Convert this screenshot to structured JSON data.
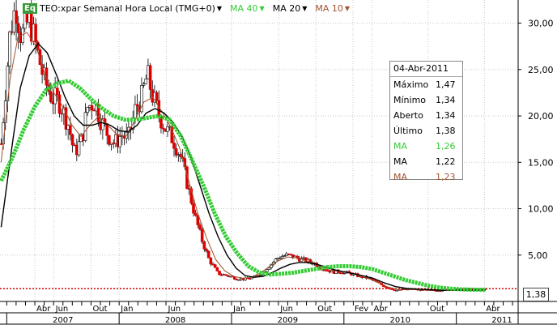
{
  "header": {
    "symbol_badge": "Eq",
    "title": "TEO:xpar Semanal Hora Local (TMG+0)",
    "indicators": [
      {
        "label": "MA 40",
        "color": "#33cc33"
      },
      {
        "label": "MA 20",
        "color": "#000000"
      },
      {
        "label": "MA 10",
        "color": "#a0522d"
      }
    ]
  },
  "info_panel": {
    "date": "04-Abr-2011",
    "rows": [
      {
        "label": "Máximo",
        "value": "1,47",
        "color": "#000000"
      },
      {
        "label": "Mínimo",
        "value": "1,34",
        "color": "#000000"
      },
      {
        "label": "Aberto",
        "value": "1,34",
        "color": "#000000"
      },
      {
        "label": "Último",
        "value": "1,38",
        "color": "#000000"
      },
      {
        "label": "MA",
        "value": "1,26",
        "color": "#33cc33"
      },
      {
        "label": "MA",
        "value": "1,22",
        "color": "#000000"
      },
      {
        "label": "MA",
        "value": "1,23",
        "color": "#a0522d"
      }
    ]
  },
  "last_price_label": "1,38",
  "chart_data": {
    "type": "candlestick",
    "y_ticks": [
      "5,00",
      "10,00",
      "15,00",
      "20,00",
      "25,00",
      "30,00"
    ],
    "y_tick_values": [
      5,
      10,
      15,
      20,
      25,
      30
    ],
    "ylim": [
      0,
      32.5
    ],
    "month_labels": [
      {
        "t": 2007.25,
        "label": "Abr"
      },
      {
        "t": 2007.42,
        "label": "Jun"
      },
      {
        "t": 2007.75,
        "label": "Out"
      },
      {
        "t": 2008.0,
        "label": "Jan"
      },
      {
        "t": 2008.42,
        "label": "Jun"
      },
      {
        "t": 2009.0,
        "label": "Jan"
      },
      {
        "t": 2009.42,
        "label": "Jun"
      },
      {
        "t": 2009.75,
        "label": "Out"
      },
      {
        "t": 2010.08,
        "label": "Fev"
      },
      {
        "t": 2010.25,
        "label": "Abr"
      },
      {
        "t": 2010.75,
        "label": "Out"
      },
      {
        "t": 2011.25,
        "label": "Abr"
      }
    ],
    "year_labels": [
      {
        "t": 2007.5,
        "label": "2007"
      },
      {
        "t": 2008.5,
        "label": "2008"
      },
      {
        "t": 2009.5,
        "label": "2009"
      },
      {
        "t": 2010.5,
        "label": "2010"
      },
      {
        "t": 2011.5,
        "label": "2011"
      }
    ],
    "x_range": [
      2006.94,
      2011.55
    ],
    "price_path": [
      [
        2006.95,
        17.0
      ],
      [
        2007.03,
        29.0
      ],
      [
        2007.08,
        32.0
      ],
      [
        2007.13,
        28.5
      ],
      [
        2007.2,
        30.5
      ],
      [
        2007.27,
        27.0
      ],
      [
        2007.33,
        24.0
      ],
      [
        2007.4,
        22.0
      ],
      [
        2007.47,
        21.5
      ],
      [
        2007.55,
        19.0
      ],
      [
        2007.6,
        16.0
      ],
      [
        2007.67,
        17.5
      ],
      [
        2007.72,
        21.0
      ],
      [
        2007.78,
        21.5
      ],
      [
        2007.84,
        19.5
      ],
      [
        2007.9,
        18.0
      ],
      [
        2007.96,
        17.0
      ],
      [
        2008.02,
        18.0
      ],
      [
        2008.08,
        17.5
      ],
      [
        2008.15,
        21.0
      ],
      [
        2008.2,
        22.0
      ],
      [
        2008.25,
        24.5
      ],
      [
        2008.3,
        22.0
      ],
      [
        2008.36,
        20.0
      ],
      [
        2008.42,
        18.5
      ],
      [
        2008.48,
        17.5
      ],
      [
        2008.55,
        15.5
      ],
      [
        2008.62,
        12.0
      ],
      [
        2008.68,
        9.0
      ],
      [
        2008.74,
        6.5
      ],
      [
        2008.8,
        4.5
      ],
      [
        2008.88,
        3.0
      ],
      [
        2008.96,
        2.8
      ],
      [
        2009.04,
        2.5
      ],
      [
        2009.12,
        2.4
      ],
      [
        2009.2,
        2.6
      ],
      [
        2009.28,
        3.2
      ],
      [
        2009.35,
        4.0
      ],
      [
        2009.42,
        4.8
      ],
      [
        2009.5,
        5.0
      ],
      [
        2009.58,
        4.7
      ],
      [
        2009.66,
        4.4
      ],
      [
        2009.74,
        4.1
      ],
      [
        2009.82,
        3.5
      ],
      [
        2009.9,
        3.2
      ],
      [
        2009.98,
        3.2
      ],
      [
        2010.06,
        3.0
      ],
      [
        2010.14,
        2.7
      ],
      [
        2010.22,
        2.5
      ],
      [
        2010.3,
        2.0
      ],
      [
        2010.38,
        1.5
      ],
      [
        2010.46,
        1.2
      ],
      [
        2010.55,
        1.3
      ],
      [
        2010.63,
        1.3
      ],
      [
        2010.72,
        1.2
      ],
      [
        2010.8,
        1.2
      ],
      [
        2010.9,
        1.25
      ],
      [
        2011.0,
        1.3
      ],
      [
        2011.1,
        1.35
      ],
      [
        2011.18,
        1.3
      ],
      [
        2011.26,
        1.38
      ]
    ],
    "ma40_path": [
      [
        2006.95,
        13.0
      ],
      [
        2007.05,
        15.5
      ],
      [
        2007.15,
        18.5
      ],
      [
        2007.25,
        21.0
      ],
      [
        2007.35,
        22.8
      ],
      [
        2007.45,
        23.5
      ],
      [
        2007.55,
        23.8
      ],
      [
        2007.65,
        23.0
      ],
      [
        2007.75,
        21.8
      ],
      [
        2007.85,
        20.8
      ],
      [
        2007.95,
        20.0
      ],
      [
        2008.05,
        19.6
      ],
      [
        2008.15,
        19.6
      ],
      [
        2008.25,
        19.8
      ],
      [
        2008.35,
        20.0
      ],
      [
        2008.45,
        19.6
      ],
      [
        2008.55,
        17.8
      ],
      [
        2008.65,
        15.2
      ],
      [
        2008.75,
        12.5
      ],
      [
        2008.85,
        9.5
      ],
      [
        2008.95,
        7.0
      ],
      [
        2009.05,
        5.2
      ],
      [
        2009.15,
        3.8
      ],
      [
        2009.25,
        3.1
      ],
      [
        2009.35,
        2.9
      ],
      [
        2009.45,
        3.0
      ],
      [
        2009.55,
        3.1
      ],
      [
        2009.65,
        3.3
      ],
      [
        2009.75,
        3.5
      ],
      [
        2009.85,
        3.7
      ],
      [
        2009.95,
        3.8
      ],
      [
        2010.05,
        3.8
      ],
      [
        2010.15,
        3.7
      ],
      [
        2010.25,
        3.5
      ],
      [
        2010.35,
        3.1
      ],
      [
        2010.45,
        2.7
      ],
      [
        2010.55,
        2.3
      ],
      [
        2010.65,
        2.0
      ],
      [
        2010.75,
        1.7
      ],
      [
        2010.85,
        1.5
      ],
      [
        2010.95,
        1.38
      ],
      [
        2011.05,
        1.3
      ],
      [
        2011.15,
        1.27
      ],
      [
        2011.26,
        1.26
      ]
    ],
    "ma20_path": [
      [
        2006.95,
        8.0
      ],
      [
        2007.05,
        17.0
      ],
      [
        2007.12,
        23.0
      ],
      [
        2007.2,
        26.5
      ],
      [
        2007.28,
        27.8
      ],
      [
        2007.36,
        26.8
      ],
      [
        2007.44,
        24.5
      ],
      [
        2007.52,
        22.0
      ],
      [
        2007.6,
        20.0
      ],
      [
        2007.68,
        19.0
      ],
      [
        2007.76,
        19.0
      ],
      [
        2007.84,
        19.3
      ],
      [
        2007.92,
        19.0
      ],
      [
        2008.0,
        18.4
      ],
      [
        2008.08,
        18.3
      ],
      [
        2008.16,
        19.0
      ],
      [
        2008.24,
        20.3
      ],
      [
        2008.32,
        20.8
      ],
      [
        2008.4,
        20.3
      ],
      [
        2008.48,
        19.3
      ],
      [
        2008.56,
        17.8
      ],
      [
        2008.64,
        15.5
      ],
      [
        2008.72,
        12.5
      ],
      [
        2008.8,
        9.5
      ],
      [
        2008.88,
        7.0
      ],
      [
        2008.96,
        5.0
      ],
      [
        2009.04,
        3.6
      ],
      [
        2009.12,
        2.8
      ],
      [
        2009.2,
        2.6
      ],
      [
        2009.28,
        2.7
      ],
      [
        2009.36,
        3.1
      ],
      [
        2009.44,
        3.6
      ],
      [
        2009.52,
        4.0
      ],
      [
        2009.6,
        4.2
      ],
      [
        2009.68,
        4.2
      ],
      [
        2009.76,
        4.0
      ],
      [
        2009.84,
        3.7
      ],
      [
        2009.92,
        3.4
      ],
      [
        2010.0,
        3.2
      ],
      [
        2010.08,
        3.0
      ],
      [
        2010.16,
        2.8
      ],
      [
        2010.26,
        2.5
      ],
      [
        2010.36,
        2.0
      ],
      [
        2010.46,
        1.6
      ],
      [
        2010.56,
        1.4
      ],
      [
        2010.7,
        1.3
      ],
      [
        2010.85,
        1.22
      ],
      [
        2011.0,
        1.2
      ],
      [
        2011.15,
        1.21
      ],
      [
        2011.26,
        1.22
      ]
    ],
    "ma10_path": [
      [
        2006.95,
        15.0
      ],
      [
        2007.03,
        24.0
      ],
      [
        2007.1,
        28.5
      ],
      [
        2007.18,
        29.0
      ],
      [
        2007.26,
        27.5
      ],
      [
        2007.34,
        24.5
      ],
      [
        2007.42,
        22.5
      ],
      [
        2007.5,
        21.0
      ],
      [
        2007.58,
        19.0
      ],
      [
        2007.66,
        17.8
      ],
      [
        2007.74,
        19.0
      ],
      [
        2007.82,
        20.0
      ],
      [
        2007.9,
        19.0
      ],
      [
        2007.98,
        18.0
      ],
      [
        2008.06,
        17.8
      ],
      [
        2008.14,
        19.5
      ],
      [
        2008.22,
        21.5
      ],
      [
        2008.3,
        22.0
      ],
      [
        2008.38,
        20.5
      ],
      [
        2008.46,
        18.8
      ],
      [
        2008.54,
        16.5
      ],
      [
        2008.62,
        13.0
      ],
      [
        2008.7,
        9.5
      ],
      [
        2008.78,
        6.8
      ],
      [
        2008.86,
        4.5
      ],
      [
        2008.94,
        3.3
      ],
      [
        2009.02,
        2.7
      ],
      [
        2009.1,
        2.5
      ],
      [
        2009.18,
        2.6
      ],
      [
        2009.26,
        3.1
      ],
      [
        2009.34,
        3.8
      ],
      [
        2009.42,
        4.4
      ],
      [
        2009.5,
        4.8
      ],
      [
        2009.58,
        4.7
      ],
      [
        2009.66,
        4.4
      ],
      [
        2009.74,
        4.1
      ],
      [
        2009.82,
        3.6
      ],
      [
        2009.9,
        3.3
      ],
      [
        2009.98,
        3.2
      ],
      [
        2010.08,
        3.0
      ],
      [
        2010.18,
        2.6
      ],
      [
        2010.28,
        2.2
      ],
      [
        2010.38,
        1.6
      ],
      [
        2010.48,
        1.3
      ],
      [
        2010.6,
        1.28
      ],
      [
        2010.75,
        1.2
      ],
      [
        2010.9,
        1.22
      ],
      [
        2011.05,
        1.25
      ],
      [
        2011.26,
        1.23
      ]
    ],
    "last_value": 1.38,
    "grid": true,
    "candle_up_color": "#ffffff",
    "candle_down_color": "#dd0000",
    "ma40_color": "#33cc33",
    "ma20_color": "#000000",
    "ma10_color": "#a0522d",
    "last_line_color": "#cc0000"
  }
}
